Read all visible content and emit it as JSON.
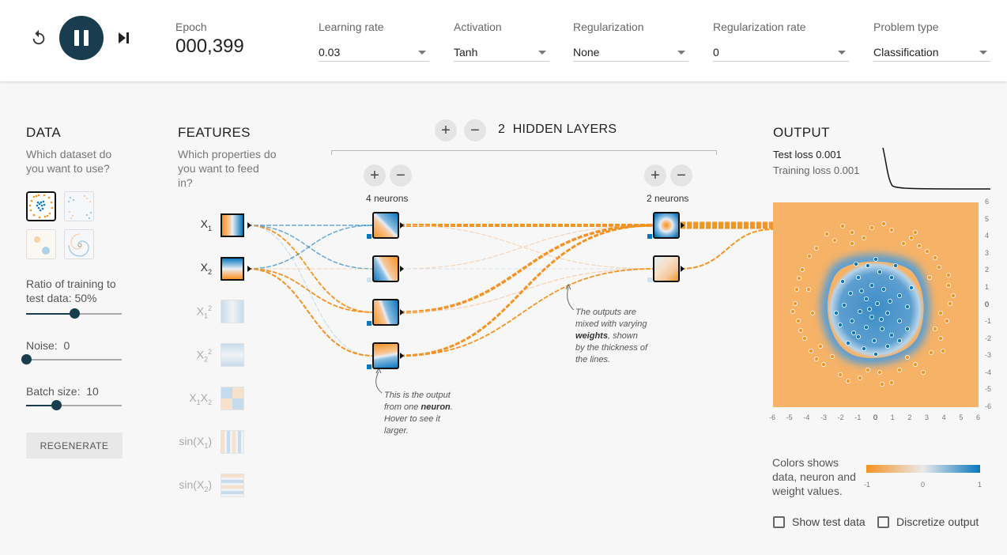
{
  "header": {
    "reset_icon": "reset-icon",
    "play_pause_icon": "pause-icon",
    "step_icon": "step-forward-icon",
    "epoch_label": "Epoch",
    "epoch_value": "000,399",
    "learning_rate": {
      "label": "Learning rate",
      "value": "0.03"
    },
    "activation": {
      "label": "Activation",
      "value": "Tanh"
    },
    "regularization": {
      "label": "Regularization",
      "value": "None"
    },
    "regularization_rate": {
      "label": "Regularization rate",
      "value": "0"
    },
    "problem_type": {
      "label": "Problem type",
      "value": "Classification"
    }
  },
  "data_panel": {
    "title": "DATA",
    "subtitle": "Which dataset do you want to use?",
    "ratio_label": "Ratio of training to test data:",
    "ratio_value": "50%",
    "ratio_fraction": 0.5,
    "noise_label": "Noise:",
    "noise_value": "0",
    "noise_fraction": 0.0,
    "batch_label": "Batch size:",
    "batch_value": "10",
    "batch_fraction": 0.31,
    "regenerate_label": "REGENERATE"
  },
  "features_panel": {
    "title": "FEATURES",
    "subtitle": "Which properties do you want to feed in?"
  },
  "network": {
    "hidden_layers_count": "2",
    "hidden_layers_label": "HIDDEN LAYERS",
    "layer1_neurons": "4 neurons",
    "layer2_neurons": "2 neurons",
    "note_neuron_1": "This is the output",
    "note_neuron_2": "from one",
    "note_neuron_bold": "neuron",
    "note_neuron_3": ". Hover to see it",
    "note_neuron_4": "larger.",
    "note_weights_1": "The outputs are",
    "note_weights_2": "mixed with varying",
    "note_weights_bold": "weights",
    "note_weights_3": ", shown",
    "note_weights_4": "by the thickness of",
    "note_weights_5": "the lines."
  },
  "output_panel": {
    "title": "OUTPUT",
    "test_loss_label": "Test loss",
    "test_loss_value": "0.001",
    "training_loss_label": "Training loss",
    "training_loss_value": "0.001",
    "x_ticks": [
      "-6",
      "-5",
      "-4",
      "-3",
      "-2",
      "-1",
      "0",
      "1",
      "2",
      "3",
      "4",
      "5",
      "6"
    ],
    "y_ticks": [
      "6",
      "5",
      "4",
      "3",
      "2",
      "1",
      "0",
      "-1",
      "-2",
      "-3",
      "-4",
      "-5",
      "-6"
    ],
    "legend_text": "Colors shows data, neuron and weight values.",
    "legend_ticks": [
      "-1",
      "0",
      "1"
    ],
    "show_test_data": "Show test data",
    "discretize_output": "Discretize output"
  },
  "colors": {
    "orange": "#f59322",
    "blue": "#0877bd",
    "dark": "#183d4e"
  }
}
